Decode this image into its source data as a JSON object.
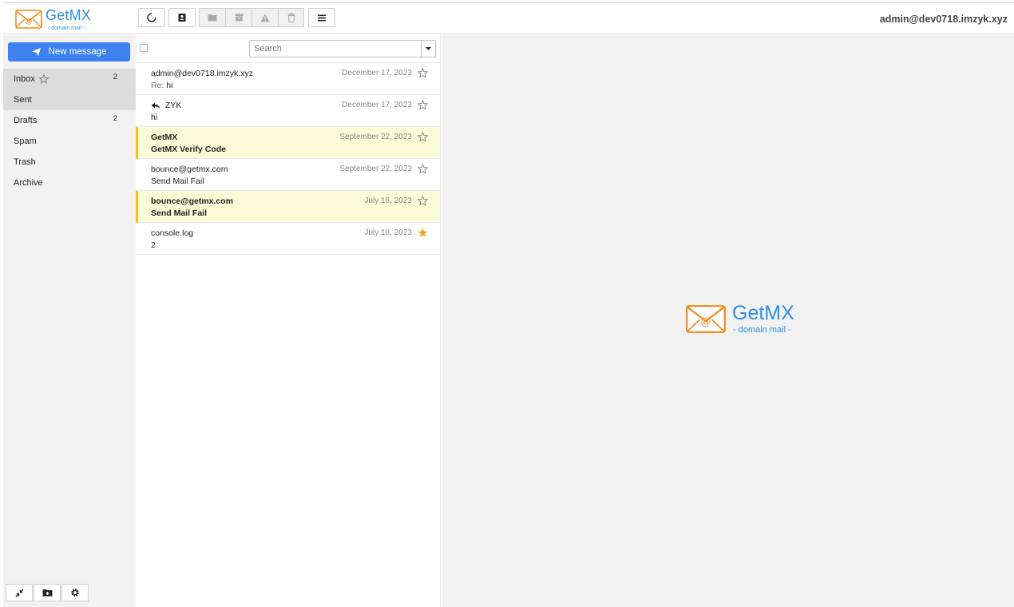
{
  "app": {
    "logo_title": "GetMX",
    "logo_subtitle": "- domain mail -",
    "user_email": "admin@dev0718.imzyk.xyz",
    "accent_color": "#3d82f0",
    "logo_color": "#2e8fe0",
    "envelope_color": "#f08a1c"
  },
  "toolbar": {
    "buttons": [
      "refresh-icon",
      "contacts-icon",
      "move-folder-icon",
      "archive-icon",
      "spam-warning-icon",
      "delete-trash-icon",
      "menu-icon"
    ]
  },
  "sidebar": {
    "new_message_label": "New message",
    "folders": [
      {
        "label": "Inbox",
        "count": "2",
        "active": true,
        "starred_icon": true
      },
      {
        "label": "Sent",
        "count": "",
        "active": true
      },
      {
        "label": "Drafts",
        "count": "2"
      },
      {
        "label": "Spam",
        "count": ""
      },
      {
        "label": "Trash",
        "count": ""
      },
      {
        "label": "Archive",
        "count": ""
      }
    ],
    "bottom_buttons": [
      "collapse-icon",
      "folder-add-icon",
      "settings-gear-icon"
    ]
  },
  "list": {
    "search_placeholder": "Search",
    "messages": [
      {
        "from": "admin@dev0718.imzyk.xyz",
        "subject_prefix": "Re:",
        "subject": "hi",
        "date": "December 17, 2023",
        "unread": false,
        "starred": false,
        "replied": false
      },
      {
        "from": "ZYK",
        "subject_prefix": "",
        "subject": "hi",
        "date": "December 17, 2023",
        "unread": false,
        "starred": false,
        "replied": true
      },
      {
        "from": "GetMX",
        "subject_prefix": "",
        "subject": "GetMX Verify Code",
        "date": "September 22, 2023",
        "unread": true,
        "starred": false,
        "replied": false
      },
      {
        "from": "bounce@getmx.com",
        "subject_prefix": "",
        "subject": "Send Mail Fail",
        "date": "September 22, 2023",
        "unread": false,
        "starred": false,
        "replied": false
      },
      {
        "from": "bounce@getmx.com",
        "subject_prefix": "",
        "subject": "Send Mail Fail",
        "date": "July 18, 2023",
        "unread": true,
        "starred": false,
        "replied": false
      },
      {
        "from": "console.log",
        "subject_prefix": "",
        "subject": "2",
        "date": "July 18, 2023",
        "unread": false,
        "starred": true,
        "replied": false
      }
    ]
  },
  "preview": {
    "logo_title": "GetMX",
    "logo_subtitle": "- domain mail -"
  }
}
